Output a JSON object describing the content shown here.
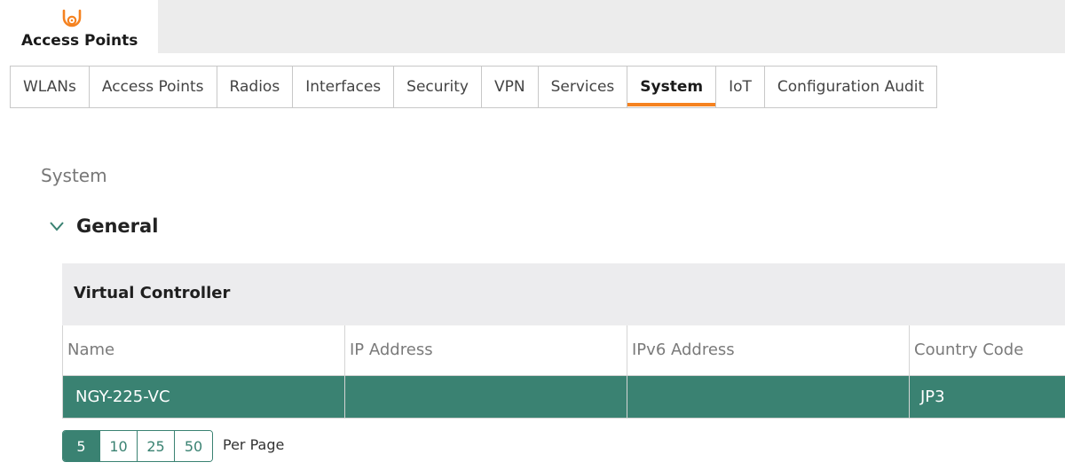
{
  "header": {
    "app_title": "Access Points",
    "app_icon": "access-point-icon",
    "accent_color": "#f58220"
  },
  "tabs": [
    {
      "label": "WLANs",
      "active": false
    },
    {
      "label": "Access Points",
      "active": false
    },
    {
      "label": "Radios",
      "active": false
    },
    {
      "label": "Interfaces",
      "active": false
    },
    {
      "label": "Security",
      "active": false
    },
    {
      "label": "VPN",
      "active": false
    },
    {
      "label": "Services",
      "active": false
    },
    {
      "label": "System",
      "active": true
    },
    {
      "label": "IoT",
      "active": false
    },
    {
      "label": "Configuration Audit",
      "active": false
    }
  ],
  "page": {
    "section_title": "System",
    "group_title": "General",
    "group_icon": "chevron-down-icon"
  },
  "virtual_controller": {
    "title": "Virtual Controller",
    "columns": [
      "Name",
      "IP Address",
      "IPv6 Address",
      "Country Code"
    ],
    "rows": [
      {
        "name": "NGY-225-VC",
        "ip": "",
        "ipv6": "",
        "country_code": "JP3"
      }
    ],
    "row_color": "#3a8272"
  },
  "pagination": {
    "options": [
      "5",
      "10",
      "25",
      "50"
    ],
    "selected": "5",
    "label": "Per Page"
  }
}
